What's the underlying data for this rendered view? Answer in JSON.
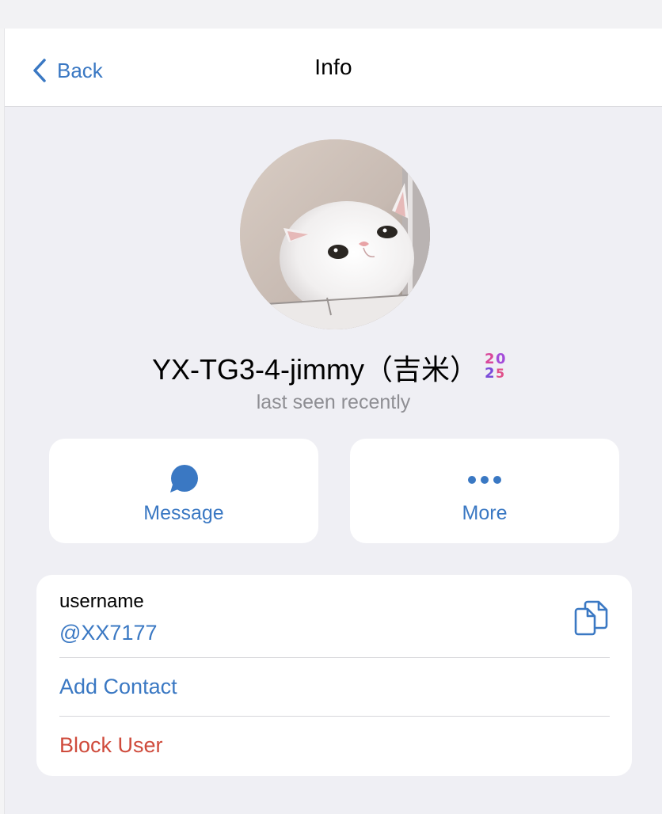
{
  "navbar": {
    "back_label": "Back",
    "title": "Info"
  },
  "profile": {
    "name": "YX-TG3-4-jimmy（吉米）",
    "badge_icon": "2025-emoji-badge-icon",
    "status": "last seen recently",
    "avatar": "white-cat-photo"
  },
  "actions": [
    {
      "label": "Message",
      "icon": "speech-bubble-icon"
    },
    {
      "label": "More",
      "icon": "more-dots-icon"
    }
  ],
  "info": {
    "username_label": "username",
    "username_value": "@XX7177",
    "copy_icon": "copy-icon",
    "add_contact": "Add Contact",
    "block_user": "Block User"
  },
  "colors": {
    "accent": "#3a78c3",
    "destructive": "#cf4b3c",
    "secondary_text": "#8e8e93",
    "background": "#efeff4"
  }
}
